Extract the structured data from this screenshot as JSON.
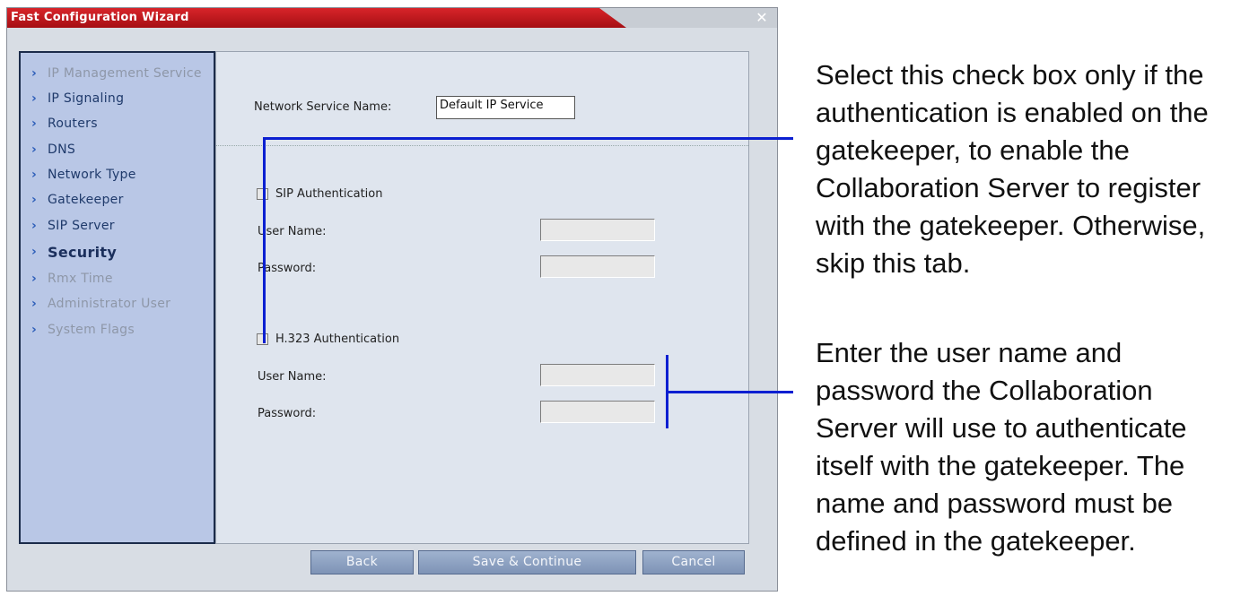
{
  "window": {
    "title": "Fast Configuration Wizard",
    "close_glyph": "✕"
  },
  "nav": {
    "items": [
      {
        "label": "IP Management Service",
        "state": "disabled"
      },
      {
        "label": "IP Signaling",
        "state": "normal"
      },
      {
        "label": "Routers",
        "state": "normal"
      },
      {
        "label": "DNS",
        "state": "normal"
      },
      {
        "label": "Network Type",
        "state": "normal"
      },
      {
        "label": "Gatekeeper",
        "state": "normal"
      },
      {
        "label": "SIP Server",
        "state": "normal"
      },
      {
        "label": "Security",
        "state": "active"
      },
      {
        "label": "Rmx Time",
        "state": "disabled"
      },
      {
        "label": "Administrator User",
        "state": "disabled"
      },
      {
        "label": "System Flags",
        "state": "disabled"
      }
    ],
    "chevron": "›"
  },
  "form": {
    "network_service_label": "Network Service Name:",
    "network_service_value": "Default IP Service",
    "sip": {
      "checkbox_label": "SIP Authentication",
      "checked": false,
      "user_label": "User Name:",
      "password_label": "Password:",
      "user_value": "",
      "password_value": ""
    },
    "h323": {
      "checkbox_label": "H.323 Authentication",
      "checked": false,
      "user_label": "User Name:",
      "password_label": "Password:",
      "user_value": "",
      "password_value": ""
    }
  },
  "buttons": {
    "back": "Back",
    "save_continue": "Save & Continue",
    "cancel": "Cancel"
  },
  "annotations": {
    "checkbox_note": [
      "Select this check box only if the",
      "authentication is enabled on the",
      "gatekeeper, to enable the",
      "Collaboration Server to register",
      "with the gatekeeper. Otherwise,",
      "skip this tab."
    ],
    "credentials_note": [
      "Enter the user name and",
      "password the Collaboration",
      "Server will use to authenticate",
      "itself with the gatekeeper. The",
      "name and password must be",
      "defined in the gatekeeper."
    ],
    "callout_color": "#0b1fd1"
  }
}
